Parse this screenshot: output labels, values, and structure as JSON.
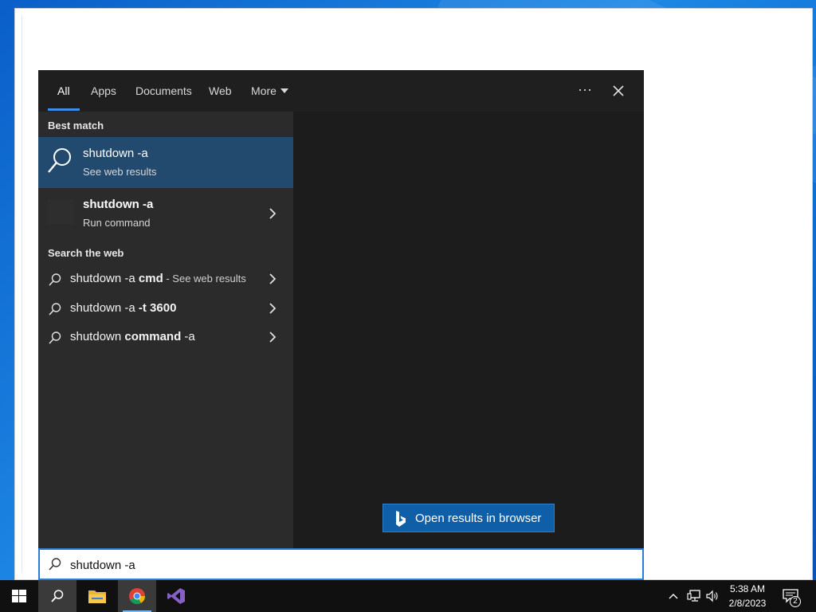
{
  "tabs": [
    {
      "label": "All"
    },
    {
      "label": "Apps"
    },
    {
      "label": "Documents"
    },
    {
      "label": "Web"
    },
    {
      "label": "More"
    }
  ],
  "more_options_label": "···",
  "best_match": {
    "header": "Best match",
    "items": [
      {
        "title": "shutdown -a",
        "subtitle": "See web results",
        "icon": "search-icon"
      },
      {
        "title": "shutdown -a",
        "subtitle": "Run command",
        "icon": "app-icon"
      }
    ]
  },
  "search_web": {
    "header": "Search the web",
    "items": [
      {
        "normal": "shutdown -a ",
        "bold": "cmd",
        "hint": " - See web results"
      },
      {
        "normal": "shutdown -a ",
        "bold": "-t 3600",
        "hint": ""
      },
      {
        "normal": "shutdown ",
        "bold": "command",
        "normal2": " -a"
      }
    ]
  },
  "open_browser_label": "Open results in browser",
  "search_box": {
    "value": "shutdown -a"
  },
  "taskbar": {
    "time": "5:38 AM",
    "date": "2/8/2023",
    "notification_count": "2"
  },
  "colors": {
    "accent": "#3a8ee6",
    "selected_row": "#224a6e",
    "bing_button": "#0f5ea8"
  }
}
